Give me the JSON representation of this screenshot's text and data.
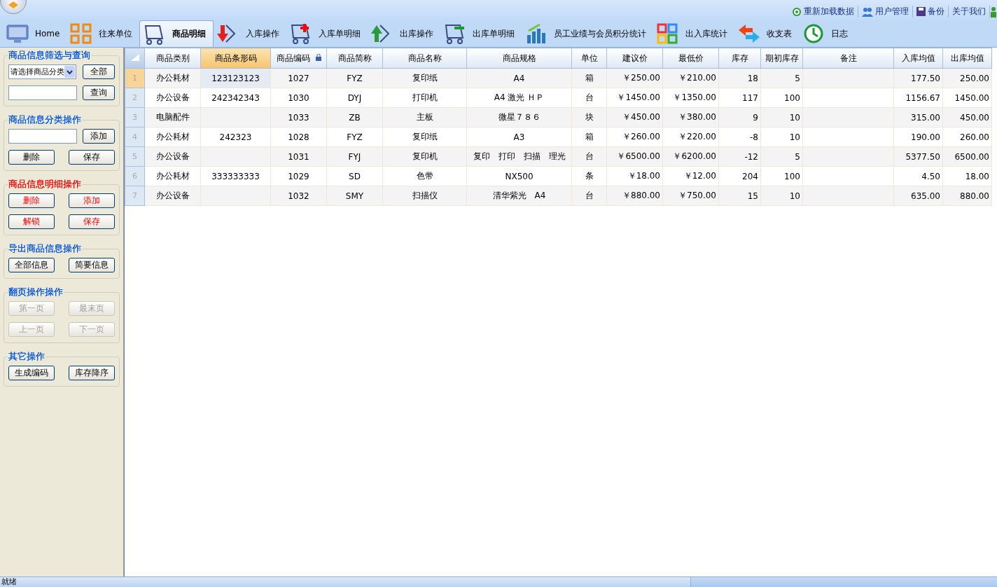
{
  "top_links": [
    "重新加载数据",
    "用户管理",
    "备份",
    "关于我们"
  ],
  "tabs": [
    {
      "label": "Home",
      "selected": false
    },
    {
      "label": "往来单位",
      "selected": false
    },
    {
      "label": "商品明细",
      "selected": true
    },
    {
      "label": "入库操作",
      "selected": false
    },
    {
      "label": "入库单明细",
      "selected": false
    },
    {
      "label": "出库操作",
      "selected": false
    },
    {
      "label": "出库单明细",
      "selected": false
    },
    {
      "label": "员工业绩与会员积分统计",
      "selected": false
    },
    {
      "label": "出入库统计",
      "selected": false
    },
    {
      "label": "收支表",
      "selected": false
    },
    {
      "label": "日志",
      "selected": false
    }
  ],
  "sidebar": {
    "groups": [
      {
        "title": "商品信息筛选与查询",
        "color": "#0055e5",
        "select": {
          "value": "请选择商品分类"
        },
        "rows": [
          [
            {
              "kind": "button",
              "label": "全部",
              "disabled": false
            }
          ],
          [
            {
              "kind": "input"
            },
            {
              "kind": "button",
              "label": "查询",
              "disabled": false
            }
          ]
        ]
      },
      {
        "title": "商品信息分类操作",
        "color": "#0055e5",
        "rows": [
          [
            {
              "kind": "input"
            },
            {
              "kind": "button",
              "label": "添加",
              "disabled": false
            }
          ],
          [
            {
              "kind": "button",
              "label": "删除",
              "disabled": false
            },
            {
              "kind": "button",
              "label": "保存",
              "disabled": false
            }
          ]
        ]
      },
      {
        "title": "商品信息明细操作",
        "color": "#ff0000",
        "rows": [
          [
            {
              "kind": "button",
              "label": "删除",
              "disabled": false
            },
            {
              "kind": "button",
              "label": "添加",
              "disabled": false
            }
          ],
          [
            {
              "kind": "button",
              "label": "解锁",
              "disabled": false
            },
            {
              "kind": "button",
              "label": "保存",
              "disabled": false
            }
          ]
        ]
      },
      {
        "title": "导出商品信息操作",
        "color": "#0055e5",
        "rows": [
          [
            {
              "kind": "button",
              "label": "全部信息",
              "disabled": false
            },
            {
              "kind": "button",
              "label": "简要信息",
              "disabled": false
            }
          ]
        ]
      },
      {
        "title": "翻页操作操作",
        "color": "#0055e5",
        "rows": [
          [
            {
              "kind": "button",
              "label": "第一页",
              "disabled": true
            },
            {
              "kind": "button",
              "label": "最末页",
              "disabled": true
            }
          ],
          [
            {
              "kind": "button",
              "label": "上一页",
              "disabled": true
            },
            {
              "kind": "button",
              "label": "下一页",
              "disabled": true
            }
          ]
        ]
      },
      {
        "title": "其它操作",
        "color": "#0055e5",
        "rows": [
          [
            {
              "kind": "button",
              "label": "生成编码",
              "disabled": false
            },
            {
              "kind": "button",
              "label": "库存降序",
              "disabled": false
            }
          ]
        ]
      }
    ]
  },
  "table": {
    "columns": [
      {
        "label": "商品类别",
        "selected": false,
        "kind": "text",
        "locked": false
      },
      {
        "label": "商品条形码",
        "selected": true,
        "kind": "text",
        "locked": false
      },
      {
        "label": "商品编码",
        "selected": false,
        "kind": "text",
        "locked": true
      },
      {
        "label": "商品简称",
        "selected": false,
        "kind": "text",
        "locked": false
      },
      {
        "label": "商品名称",
        "selected": false,
        "kind": "text",
        "locked": false
      },
      {
        "label": "商品规格",
        "selected": false,
        "kind": "text",
        "locked": false
      },
      {
        "label": "单位",
        "selected": false,
        "kind": "text",
        "locked": false
      },
      {
        "label": "建议价",
        "selected": false,
        "kind": "number",
        "locked": false
      },
      {
        "label": "最低价",
        "selected": false,
        "kind": "number",
        "locked": false
      },
      {
        "label": "库存",
        "selected": false,
        "kind": "number",
        "locked": false
      },
      {
        "label": "期初库存",
        "selected": false,
        "kind": "number",
        "locked": false
      },
      {
        "label": "备注",
        "selected": false,
        "kind": "text",
        "locked": false
      },
      {
        "label": "入库均值",
        "selected": false,
        "kind": "number",
        "locked": false
      },
      {
        "label": "出库均值",
        "selected": false,
        "kind": "number",
        "locked": false
      }
    ],
    "rows": [
      {
        "number": "1",
        "selected": true,
        "cells": [
          "办公耗材",
          "123123123",
          "1027",
          "FYZ",
          "复印纸",
          "A4",
          "箱",
          "￥250.00",
          "￥210.00",
          "18",
          "5",
          "",
          "177.50",
          "250.00"
        ]
      },
      {
        "number": "2",
        "selected": false,
        "cells": [
          "办公设备",
          "242342343",
          "1030",
          "DYJ",
          "打印机",
          "A4 激光 ＨＰ",
          "台",
          "￥1450.00",
          "￥1350.00",
          "117",
          "100",
          "",
          "1156.67",
          "1450.00"
        ]
      },
      {
        "number": "3",
        "selected": false,
        "cells": [
          "电脑配件",
          "",
          "1033",
          "ZB",
          "主板",
          "微星７８６",
          "块",
          "￥450.00",
          "￥380.00",
          "9",
          "10",
          "",
          "315.00",
          "450.00"
        ]
      },
      {
        "number": "4",
        "selected": false,
        "cells": [
          "办公耗材",
          "242323",
          "1028",
          "FYZ",
          "复印纸",
          "A3",
          "箱",
          "￥260.00",
          "￥220.00",
          "-8",
          "10",
          "",
          "190.00",
          "260.00"
        ]
      },
      {
        "number": "5",
        "selected": false,
        "cells": [
          "办公设备",
          "",
          "1031",
          "FYJ",
          "复印机",
          "复印　打印　扫描　理光",
          "台",
          "￥6500.00",
          "￥6200.00",
          "-12",
          "5",
          "",
          "5377.50",
          "6500.00"
        ]
      },
      {
        "number": "6",
        "selected": false,
        "cells": [
          "办公耗材",
          "333333333",
          "1029",
          "SD",
          "色带",
          "NX500",
          "条",
          "￥18.00",
          "￥12.00",
          "204",
          "100",
          "",
          "4.50",
          "18.00"
        ]
      },
      {
        "number": "7",
        "selected": false,
        "cells": [
          "办公设备",
          "",
          "1032",
          "SMY",
          "扫描仪",
          "清华紫光　A4",
          "台",
          "￥880.00",
          "￥750.00",
          "15",
          "10",
          "",
          "635.00",
          "880.00"
        ]
      }
    ]
  },
  "status_bar": {
    "text": "就绪"
  }
}
